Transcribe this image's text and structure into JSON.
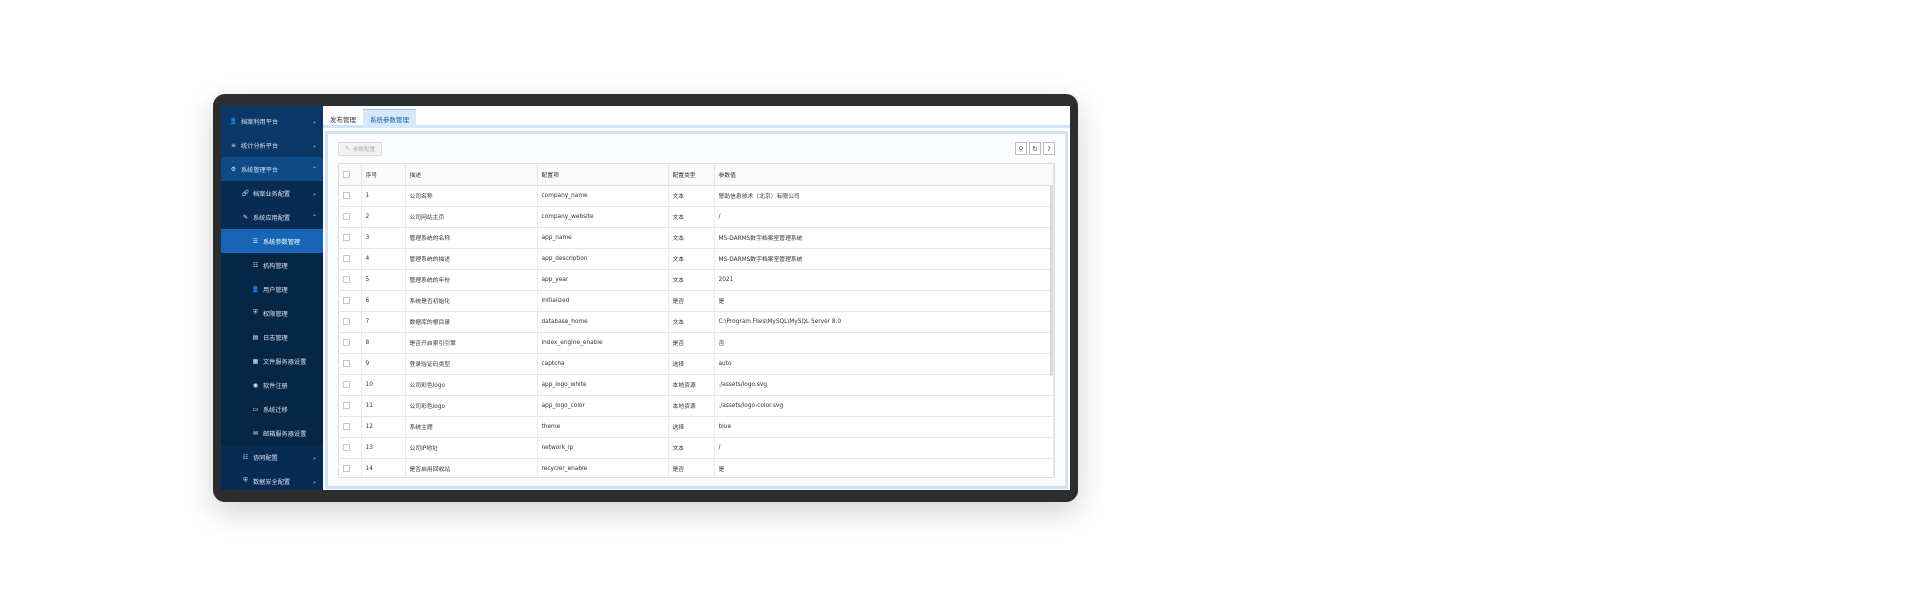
{
  "sidebar": {
    "items": [
      {
        "label": "档案利用平台",
        "icon": "user-icon",
        "level": 0,
        "state": "collapsed"
      },
      {
        "label": "统计分析平台",
        "icon": "chart-icon",
        "level": 0,
        "state": "collapsed"
      },
      {
        "label": "系统管理平台",
        "icon": "gear-icon",
        "level": 0,
        "state": "expanded"
      },
      {
        "label": "档案业务配置",
        "icon": "link-icon",
        "level": 1,
        "state": "collapsed"
      },
      {
        "label": "系统应用配置",
        "icon": "pencil-icon",
        "level": 1,
        "state": "expanded"
      },
      {
        "label": "系统参数管理",
        "icon": "sliders-icon",
        "level": 2,
        "state": "selected"
      },
      {
        "label": "机构管理",
        "icon": "org-icon",
        "level": 2,
        "state": "normal"
      },
      {
        "label": "用户管理",
        "icon": "user-icon",
        "level": 2,
        "state": "normal"
      },
      {
        "label": "权限管理",
        "icon": "shield-icon",
        "level": 2,
        "state": "normal"
      },
      {
        "label": "日志管理",
        "icon": "file-icon",
        "level": 2,
        "state": "normal"
      },
      {
        "label": "文件服务器设置",
        "icon": "grid-icon",
        "level": 2,
        "state": "normal"
      },
      {
        "label": "软件注册",
        "icon": "globe-icon",
        "level": 2,
        "state": "normal"
      },
      {
        "label": "系统迁移",
        "icon": "window-icon",
        "level": 2,
        "state": "normal"
      },
      {
        "label": "邮箱服务器设置",
        "icon": "mail-icon",
        "level": 2,
        "state": "normal"
      },
      {
        "label": "协同配置",
        "icon": "org-icon",
        "level": 1,
        "state": "collapsed"
      },
      {
        "label": "数据安全配置",
        "icon": "shield-icon",
        "level": 1,
        "state": "collapsed"
      }
    ]
  },
  "tabs": [
    {
      "label": "发布管理",
      "active": false
    },
    {
      "label": "系统参数管理",
      "active": true
    }
  ],
  "toolbar": {
    "config_button": "参数配置",
    "icons": [
      "search-icon",
      "refresh-icon",
      "help-icon"
    ]
  },
  "table": {
    "headers": [
      "序号",
      "描述",
      "配置项",
      "配置类型",
      "参数值"
    ],
    "rows": [
      [
        "1",
        "公司名称",
        "company_name",
        "文本",
        "警助信息技术（北京）有限公司"
      ],
      [
        "2",
        "公司网站主页",
        "company_website",
        "文本",
        "/"
      ],
      [
        "3",
        "管理系统的名称",
        "app_name",
        "文本",
        "MS-DARMS数字档案室管理系统"
      ],
      [
        "4",
        "管理系统的描述",
        "app_description",
        "文本",
        "MS-DARMS数字档案室管理系统"
      ],
      [
        "5",
        "管理系统的年份",
        "app_year",
        "文本",
        "2021"
      ],
      [
        "6",
        "系统是否初始化",
        "initialized",
        "是否",
        "是"
      ],
      [
        "7",
        "数据库的根目录",
        "database_home",
        "文本",
        "C:\\Program Files\\MySQL\\MySQL Server 8.0"
      ],
      [
        "8",
        "是否开启索引引擎",
        "index_engine_enable",
        "是否",
        "否"
      ],
      [
        "9",
        "登录验证码类型",
        "captcha",
        "选择",
        "auto"
      ],
      [
        "10",
        "公司彩色logo",
        "app_logo_white",
        "本地资源",
        "./assets/logo.svg"
      ],
      [
        "11",
        "公司彩色logo",
        "app_logo_color",
        "本地资源",
        "./assets/logo-color.svg"
      ],
      [
        "12",
        "系统主题",
        "theme",
        "选择",
        "blue"
      ],
      [
        "13",
        "公司IP地址",
        "network_ip",
        "文本",
        "/"
      ],
      [
        "14",
        "是否启用回收站",
        "recycler_enable",
        "是否",
        "是"
      ]
    ]
  }
}
